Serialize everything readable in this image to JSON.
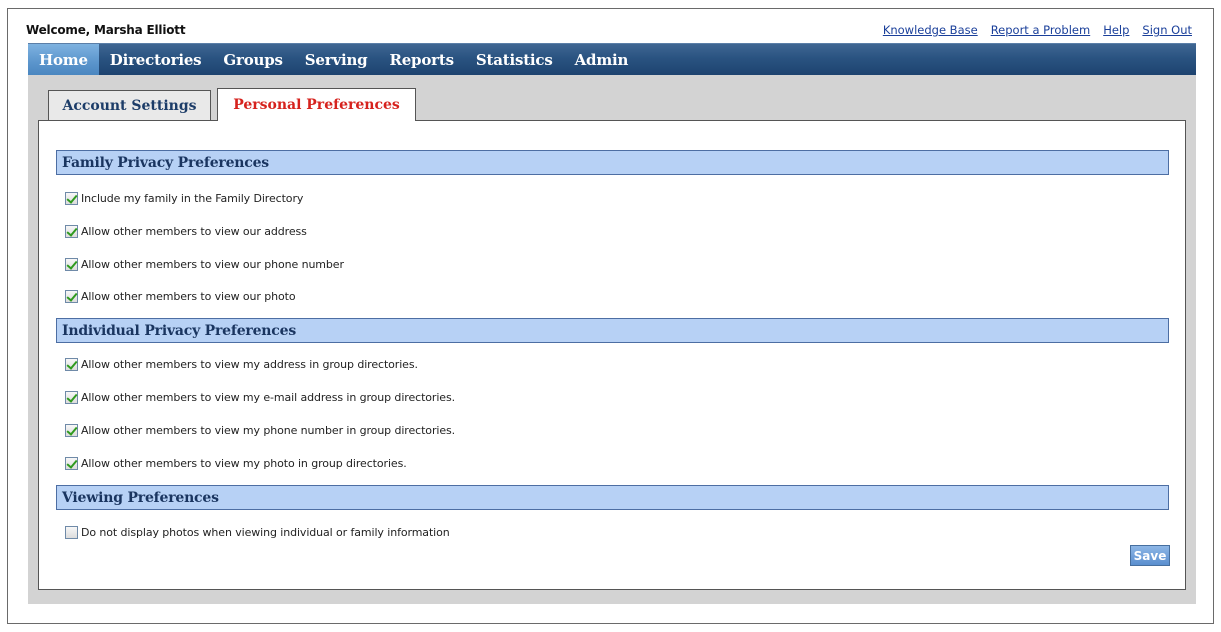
{
  "header": {
    "welcome": "Welcome, Marsha Elliott",
    "links": [
      "Knowledge Base",
      "Report a Problem",
      "Help",
      "Sign Out"
    ]
  },
  "nav": {
    "items": [
      "Home",
      "Directories",
      "Groups",
      "Serving",
      "Reports",
      "Statistics",
      "Admin"
    ],
    "active": "Home"
  },
  "tabs": {
    "account": "Account Settings",
    "personal": "Personal Preferences",
    "active": "Personal Preferences"
  },
  "sections": [
    {
      "title": "Family Privacy Preferences",
      "options": [
        {
          "label": "Include my family in the Family Directory",
          "checked": true
        },
        {
          "label": "Allow other members to view our address",
          "checked": true
        },
        {
          "label": "Allow other members to view our phone number",
          "checked": true
        },
        {
          "label": "Allow other members to view our photo",
          "checked": true
        }
      ]
    },
    {
      "title": "Individual Privacy Preferences",
      "options": [
        {
          "label": "Allow other members to view my address in group directories.",
          "checked": true
        },
        {
          "label": "Allow other members to view my e-mail address in group directories.",
          "checked": true
        },
        {
          "label": "Allow other members to view my phone number in group directories.",
          "checked": true
        },
        {
          "label": "Allow other members to view my photo in group directories.",
          "checked": true
        }
      ]
    },
    {
      "title": "Viewing Preferences",
      "options": [
        {
          "label": "Do not display photos when viewing individual or family information",
          "checked": false
        }
      ]
    }
  ],
  "save_label": "Save"
}
